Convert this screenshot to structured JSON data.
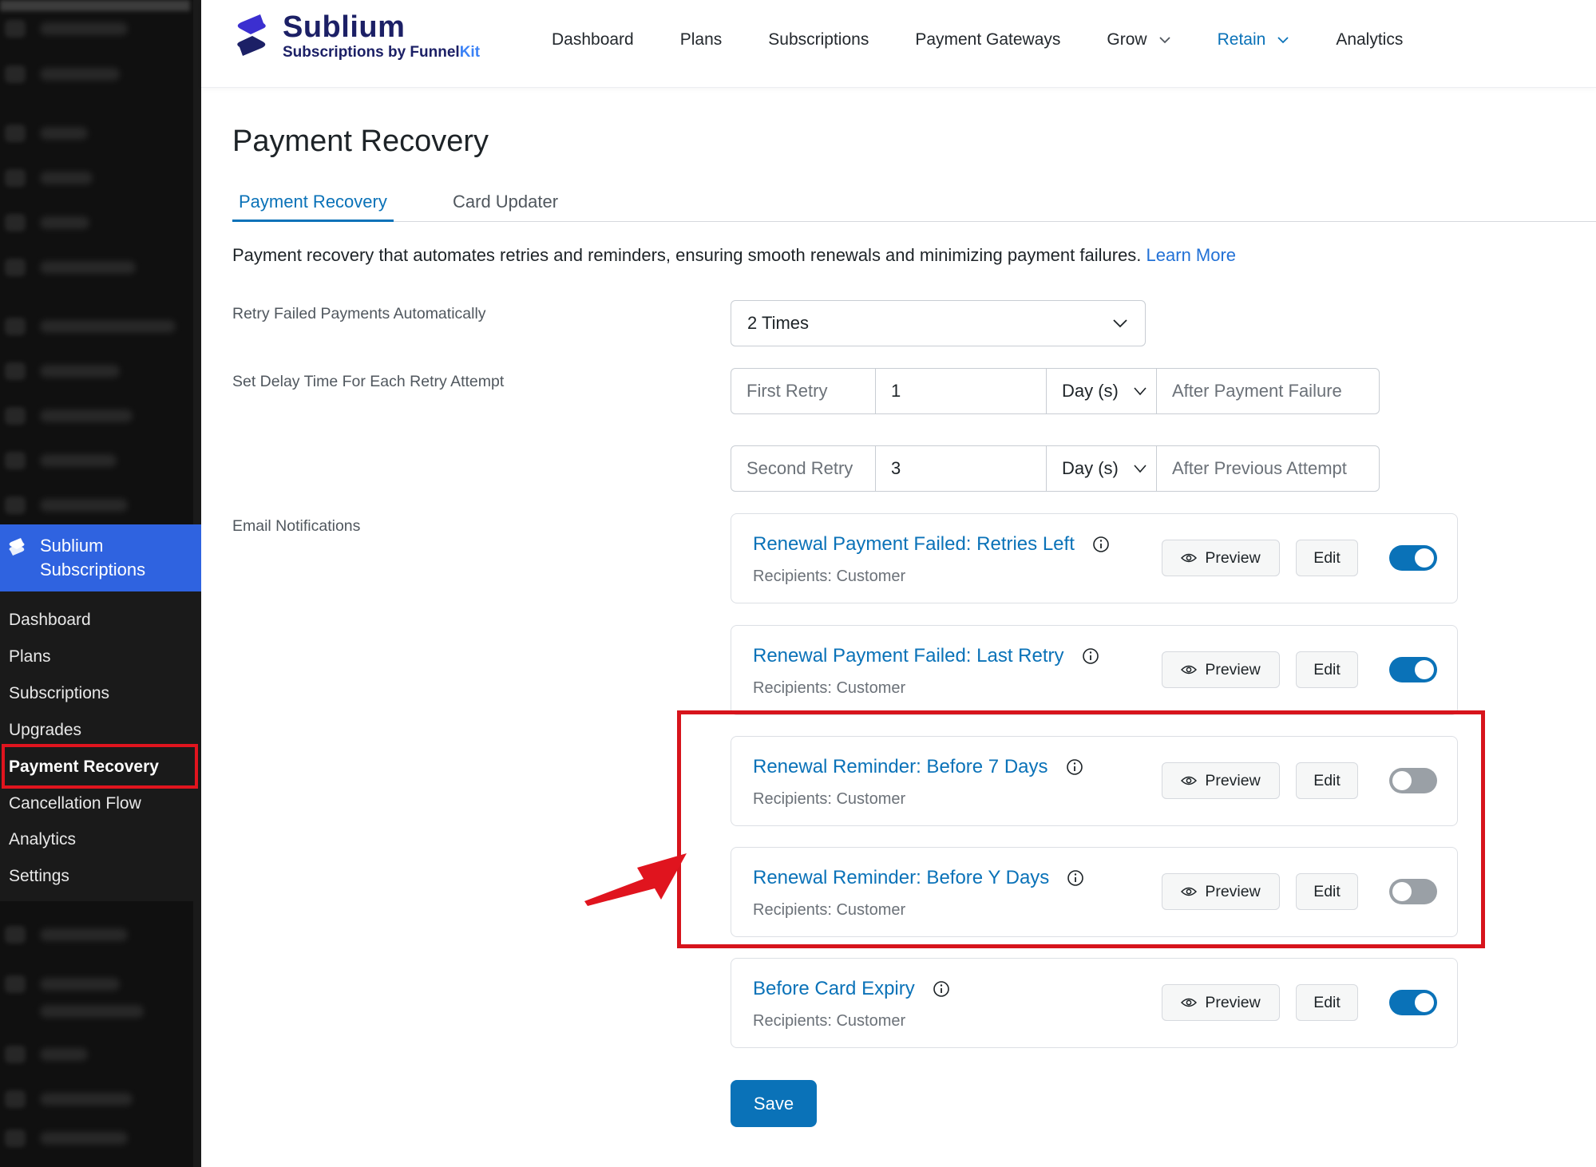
{
  "brand": {
    "name": "Sublium",
    "subtitle_prefix": "Subscriptions by Funnel",
    "subtitle_kit": "Kit"
  },
  "topnav": [
    {
      "label": "Dashboard"
    },
    {
      "label": "Plans"
    },
    {
      "label": "Subscriptions"
    },
    {
      "label": "Payment Gateways"
    },
    {
      "label": "Grow"
    },
    {
      "label": "Retain"
    },
    {
      "label": "Analytics"
    }
  ],
  "sidebar": {
    "plugin_name_line1": "Sublium",
    "plugin_name_line2": "Subscriptions",
    "items": [
      {
        "label": "Dashboard"
      },
      {
        "label": "Plans"
      },
      {
        "label": "Subscriptions"
      },
      {
        "label": "Upgrades"
      },
      {
        "label": "Payment Recovery"
      },
      {
        "label": "Cancellation Flow"
      },
      {
        "label": "Analytics"
      },
      {
        "label": "Settings"
      }
    ]
  },
  "page": {
    "title": "Payment Recovery",
    "tabs": [
      {
        "label": "Payment Recovery"
      },
      {
        "label": "Card Updater"
      }
    ],
    "description": "Payment recovery that automates retries and reminders, ensuring smooth renewals and minimizing payment failures. ",
    "learn_more": "Learn More"
  },
  "settings": {
    "retry_label": "Retry Failed Payments Automatically",
    "retry_value": "2 Times",
    "delay_label": "Set Delay Time For Each Retry Attempt",
    "retries": [
      {
        "label": "First Retry",
        "value": "1",
        "unit": "Day (s)",
        "suffix": "After Payment Failure"
      },
      {
        "label": "Second Retry",
        "value": "3",
        "unit": "Day (s)",
        "suffix": "After Previous Attempt"
      }
    ],
    "email_label": "Email Notifications"
  },
  "notifications": [
    {
      "title": "Renewal Payment Failed: Retries Left",
      "recipients": "Recipients: Customer",
      "preview": "Preview",
      "edit": "Edit",
      "enabled": true
    },
    {
      "title": "Renewal Payment Failed: Last Retry",
      "recipients": "Recipients: Customer",
      "preview": "Preview",
      "edit": "Edit",
      "enabled": true
    },
    {
      "title": "Renewal Reminder: Before 7 Days",
      "recipients": "Recipients: Customer",
      "preview": "Preview",
      "edit": "Edit",
      "enabled": false
    },
    {
      "title": "Renewal Reminder: Before Y Days",
      "recipients": "Recipients: Customer",
      "preview": "Preview",
      "edit": "Edit",
      "enabled": false
    },
    {
      "title": "Before Card Expiry",
      "recipients": "Recipients: Customer",
      "preview": "Preview",
      "edit": "Edit",
      "enabled": true
    }
  ],
  "save_label": "Save",
  "colors": {
    "accent": "#0a72b8",
    "brand": "#1c2066",
    "plugin_menu": "#2f63e0",
    "highlight": "#d7141c"
  }
}
